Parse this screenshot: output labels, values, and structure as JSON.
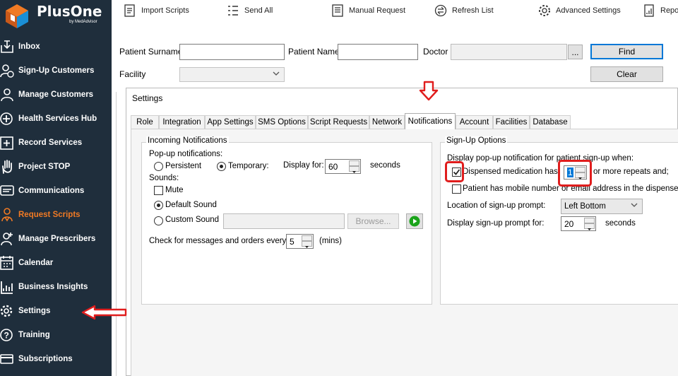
{
  "brand": {
    "name": "PlusOne",
    "sub": "by MedAdvisor"
  },
  "sidebar": {
    "items": [
      {
        "label": "Inbox",
        "icon": "inbox-icon"
      },
      {
        "label": "Sign-Up Customers",
        "icon": "sign-up-icon"
      },
      {
        "label": "Manage Customers",
        "icon": "customers-icon"
      },
      {
        "label": "Health Services Hub",
        "icon": "health-plus-icon"
      },
      {
        "label": "Record Services",
        "icon": "record-plus-icon"
      },
      {
        "label": "Project STOP",
        "icon": "hand-stop-icon"
      },
      {
        "label": "Communications",
        "icon": "chat-icon"
      },
      {
        "label": "Request Scripts",
        "icon": "request-scripts-icon",
        "active": true
      },
      {
        "label": "Manage Prescribers",
        "icon": "prescriber-icon"
      },
      {
        "label": "Calendar",
        "icon": "calendar-icon"
      },
      {
        "label": "Business Insights",
        "icon": "chart-icon"
      },
      {
        "label": "Settings",
        "icon": "gear-icon"
      },
      {
        "label": "Training",
        "icon": "help-icon"
      },
      {
        "label": "Subscriptions",
        "icon": "card-icon"
      }
    ]
  },
  "toolbar": {
    "import": "Import Scripts",
    "send_all": "Send All",
    "manual": "Manual Request",
    "refresh": "Refresh List",
    "advanced": "Advanced Settings",
    "reports": "Repo"
  },
  "search": {
    "surname_label": "Patient Surname",
    "name_label": "Patient Name",
    "doctor_label": "Doctor",
    "facility_label": "Facility",
    "browse": "...",
    "find": "Find",
    "clear": "Clear"
  },
  "dialog": {
    "title": "Settings",
    "tabs": [
      "Role",
      "Integration",
      "App Settings",
      "SMS Options",
      "Script Requests",
      "Network",
      "Notifications",
      "Account",
      "Facilities",
      "Database"
    ],
    "incoming": {
      "title": "Incoming Notifications",
      "popup_label": "Pop-up notifications:",
      "persistent": "Persistent",
      "temporary": "Temporary:",
      "display_for": "Display for:",
      "display_value": "60",
      "seconds": "seconds",
      "sounds_label": "Sounds:",
      "mute": "Mute",
      "default_sound": "Default Sound",
      "custom_sound": "Custom Sound",
      "browse": "Browse...",
      "check_label": "Check for messages and orders every:",
      "check_value": "5",
      "mins": "(mins)"
    },
    "signup": {
      "title": "Sign-Up Options",
      "display_popup": "Display pop-up notification for patient sign-up when:",
      "dispensed": "Dispensed medication has",
      "repeats_value": "1",
      "or_more": "or more repeats and;",
      "mobile": "Patient has mobile number or email address in the dispense system",
      "location_label": "Location of sign-up prompt:",
      "location_value": "Left Bottom",
      "display_prompt_label": "Display sign-up prompt for:",
      "prompt_value": "20",
      "seconds": "seconds"
    }
  },
  "colors": {
    "sidebar": "#1f2e3c",
    "active": "#f07a24",
    "annotation": "#e01d1d",
    "accent": "#0078d7"
  }
}
